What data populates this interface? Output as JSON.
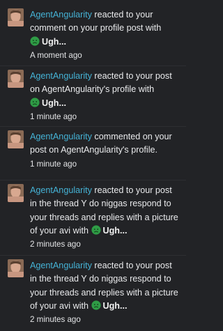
{
  "notifications": [
    {
      "user": "AgentAngularity",
      "text_l1": " reacted to your",
      "line2": "comment on your profile post with",
      "reaction": "Ugh...",
      "time": "A moment ago"
    },
    {
      "user": "AgentAngularity",
      "text_l1": " reacted to your post",
      "line2": "on AgentAngularity's profile with",
      "reaction": "Ugh...",
      "time": "1 minute ago"
    },
    {
      "user": "AgentAngularity",
      "text_l1": " commented on your",
      "line2": "post on AgentAngularity's profile.",
      "time": "1 minute ago"
    },
    {
      "user": "AgentAngularity",
      "text_l1": " reacted to your post",
      "line2": "in the thread Y do niggas respond to",
      "line3": "your threads and replies with a picture",
      "line4_prefix": "of your avi with",
      "reaction": "Ugh...",
      "time": "2 minutes ago"
    },
    {
      "user": "AgentAngularity",
      "text_l1": " reacted to your post",
      "line2": "in the thread Y do niggas respond to",
      "line3": "your threads and replies with a picture",
      "line4_prefix": "of your avi with",
      "reaction": "Ugh...",
      "time": "2 minutes ago"
    }
  ],
  "icons": {
    "avatar": "avatar-photo",
    "reaction": "ugh-face-emoji",
    "overflow": "more-dots-icon"
  },
  "colors": {
    "background": "#222326",
    "username": "#45b3d6",
    "emoji_face": "#2f9c46"
  }
}
